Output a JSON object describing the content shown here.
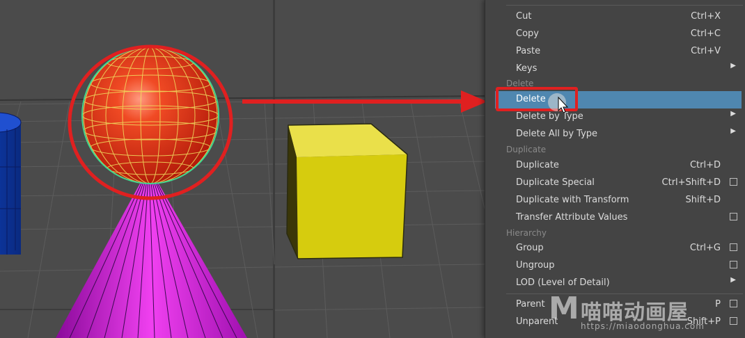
{
  "menu": {
    "items": [
      {
        "label": "Cut",
        "shortcut": "Ctrl+X"
      },
      {
        "label": "Copy",
        "shortcut": "Ctrl+C"
      },
      {
        "label": "Paste",
        "shortcut": "Ctrl+V"
      },
      {
        "label": "Keys",
        "submenu": true
      },
      {
        "label": "Delete",
        "highlighted": true
      },
      {
        "label": "Delete by Type",
        "submenu": true
      },
      {
        "label": "Delete All by Type",
        "submenu": true
      },
      {
        "label": "Duplicate",
        "shortcut": "Ctrl+D"
      },
      {
        "label": "Duplicate Special",
        "shortcut": "Ctrl+Shift+D",
        "option_box": true
      },
      {
        "label": "Duplicate with Transform",
        "shortcut": "Shift+D"
      },
      {
        "label": "Transfer Attribute Values",
        "option_box": true
      },
      {
        "label": "Group",
        "shortcut": "Ctrl+G",
        "option_box": true
      },
      {
        "label": "Ungroup",
        "option_box": true
      },
      {
        "label": "LOD (Level of Detail)",
        "submenu": true
      },
      {
        "label": "Parent",
        "shortcut": "P",
        "option_box": true
      },
      {
        "label": "Unparent",
        "shortcut": "Shift+P",
        "option_box": true
      }
    ],
    "sections": [
      "Delete",
      "Duplicate",
      "Hierarchy"
    ]
  },
  "watermark": {
    "logo": "M",
    "brand": "喵喵动画屋",
    "url": "https://miaodonghua.com"
  },
  "colors": {
    "highlight": "#4f87b0",
    "annotation_red": "#e02020",
    "sphere": "#e03010",
    "cube": "#d8cc10",
    "cone": "#d020d0",
    "cylinder": "#1848c0"
  }
}
